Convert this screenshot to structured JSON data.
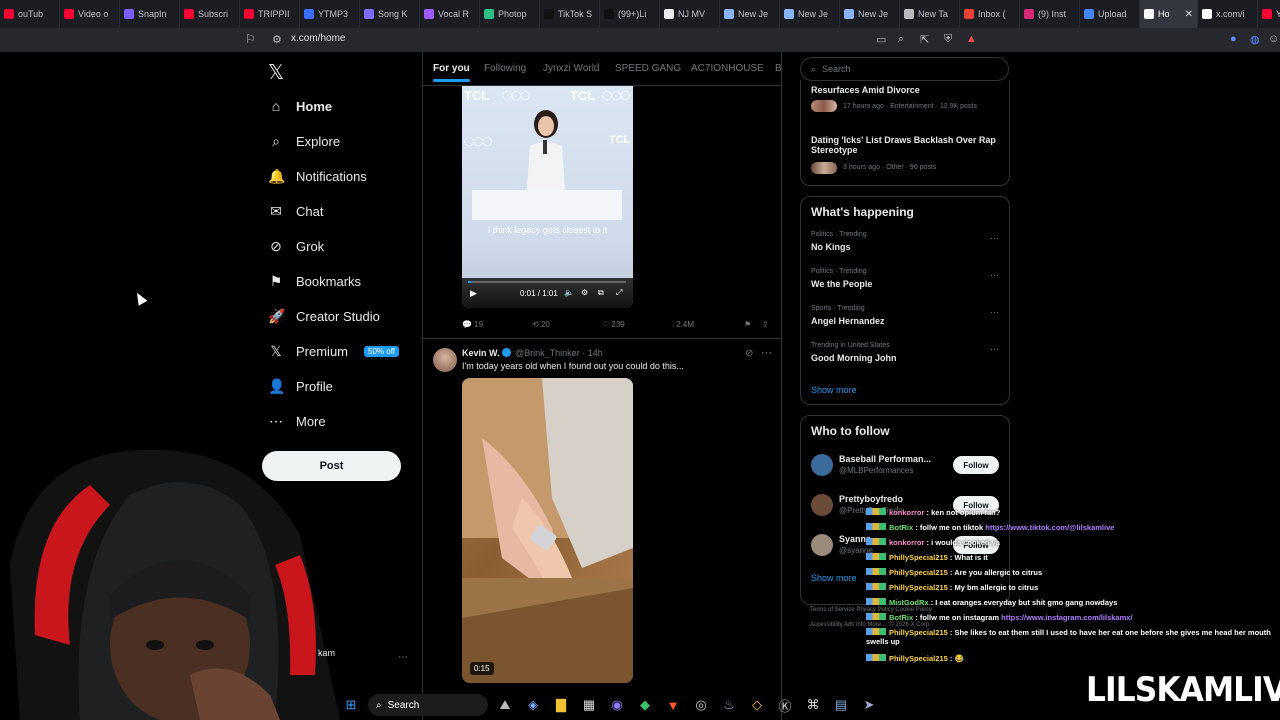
{
  "browser": {
    "tabs": [
      {
        "label": "ouTub",
        "color": "#ff0033"
      },
      {
        "label": "Video o",
        "color": "#ff0033"
      },
      {
        "label": "SnapIn",
        "color": "#7b5cff"
      },
      {
        "label": "Subscri",
        "color": "#ff0033"
      },
      {
        "label": "TRIPPII",
        "color": "#ff0033"
      },
      {
        "label": "YTMP3",
        "color": "#3b6fff"
      },
      {
        "label": "Song K",
        "color": "#7b6cff"
      },
      {
        "label": "Vocal R",
        "color": "#a05cff"
      },
      {
        "label": "Photop",
        "color": "#2bbf86"
      },
      {
        "label": "TikTok S",
        "color": "#111111"
      },
      {
        "label": "(99+)Li",
        "color": "#111111"
      },
      {
        "label": "NJ MV",
        "color": "#eeeeee"
      },
      {
        "label": "New Je",
        "color": "#8ab4f8"
      },
      {
        "label": "New Je",
        "color": "#8ab4f8"
      },
      {
        "label": "New Je",
        "color": "#8ab4f8"
      },
      {
        "label": "New Ta",
        "color": "#bbbbbb"
      },
      {
        "label": "Inbox (",
        "color": "#ea4335"
      },
      {
        "label": "(9) Inst",
        "color": "#d62976"
      },
      {
        "label": "Upload",
        "color": "#4285f4"
      },
      {
        "label": "Ho",
        "color": "#ffffff",
        "active": true,
        "close": "✕"
      },
      {
        "label": "x.com/i",
        "color": "#ffffff"
      },
      {
        "label": "YNW",
        "color": "#ff0033"
      }
    ],
    "url": "x.com/home"
  },
  "nav": {
    "items": [
      {
        "label": "Home",
        "icon": "home-icon",
        "glyph": "⌂"
      },
      {
        "label": "Explore",
        "icon": "search-icon",
        "glyph": "⌕"
      },
      {
        "label": "Notifications",
        "icon": "bell-icon",
        "glyph": "🔔"
      },
      {
        "label": "Chat",
        "icon": "mail-icon",
        "glyph": "✉"
      },
      {
        "label": "Grok",
        "icon": "grok-icon",
        "glyph": "⊘"
      },
      {
        "label": "Bookmarks",
        "icon": "bookmark-icon",
        "glyph": "⚑"
      },
      {
        "label": "Creator Studio",
        "icon": "rocket-icon",
        "glyph": "🚀"
      },
      {
        "label": "Premium",
        "icon": "x-logo-icon",
        "glyph": "𝕏",
        "badge": "50% off"
      },
      {
        "label": "Profile",
        "icon": "person-icon",
        "glyph": "👤"
      },
      {
        "label": "More",
        "icon": "more-circle-icon",
        "glyph": "⋯"
      }
    ],
    "post_label": "Post",
    "account_name": "kam"
  },
  "feed": {
    "tabs": [
      "For you",
      "Following",
      "Jynxzi World",
      "SPEED GANG",
      "AC7IONHOUSE",
      "B"
    ],
    "video1": {
      "brand": "TCL",
      "caption": "I think legacy gets closest to it",
      "time": "0:01 / 1:01",
      "progress": 0.02
    },
    "tweet1_stats": {
      "replies": "19",
      "reposts": "20",
      "likes": "239",
      "views": "2.4M"
    },
    "tweet2": {
      "name": "Kevin W.",
      "handle": "@Brink_Thinker",
      "age": "14h",
      "text": "I'm today years old when I found out you could do this...",
      "duration": "0:15"
    }
  },
  "sidebar": {
    "search_placeholder": "Search",
    "top_trends": [
      {
        "title": "Resurfaces Amid Divorce",
        "meta": "17 hours ago · Entertainment · 12.9K posts"
      },
      {
        "title": "Dating 'Icks' List Draws Backlash Over Rap Stereotype",
        "meta": "3 hours ago · Other · 96 posts"
      }
    ],
    "happening_title": "What's happening",
    "trends": [
      {
        "context": "Politics · Trending",
        "name": "No Kings"
      },
      {
        "context": "Politics · Trending",
        "name": "We the People"
      },
      {
        "context": "Sports · Trending",
        "name": "Angel Hernandez"
      },
      {
        "context": "Trending in United States",
        "name": "Good Morning John"
      }
    ],
    "show_more": "Show more",
    "who_to_follow_title": "Who to follow",
    "follow_label": "Follow",
    "suggestions": [
      {
        "name": "Baseball Performan...",
        "handle": "@MLBPerformances"
      },
      {
        "name": "Prettyboyfredo",
        "handle": "@PrettyBoyFredo"
      },
      {
        "name": "Syanne",
        "handle": "@syanne"
      }
    ],
    "follow_show_more": "Show more",
    "footer": [
      "Terms of Service  Privacy Policy  Cookie Policy",
      "Accessibility  Ads info  More ...  © 2026 X Corp."
    ]
  },
  "chat": [
    {
      "user": "konkorror",
      "text": "ken not opium fan?",
      "cls": "u"
    },
    {
      "user": "BotRix",
      "text": "follw me on tiktok ",
      "link": "https://www.tiktok.com/@lilskamlive",
      "cls": "u2"
    },
    {
      "user": "konkorror",
      "text": "i woulda cooked ya",
      "cls": "u"
    },
    {
      "user": "PhillySpecial215",
      "text": "What is it",
      "cls": "u3"
    },
    {
      "user": "PhillySpecial215",
      "text": "Are you allergic to citrus",
      "cls": "u3"
    },
    {
      "user": "PhillySpecial215",
      "text": "My bm allergic to citrus",
      "cls": "u3"
    },
    {
      "user": "MistGodRx",
      "text": "I eat oranges everyday but shit gmo gang nowdays",
      "cls": "u2"
    },
    {
      "user": "BotRix",
      "text": "follw me on instagram ",
      "link": "https://www.instagram.com/lilskamx/",
      "cls": "u2"
    },
    {
      "user": "PhillySpecial215",
      "text": "She likes to eat them still I used to have her eat one before she gives me head her mouth swells up",
      "cls": "u3"
    },
    {
      "user": "PhillySpecial215",
      "text": "😂",
      "cls": "u3"
    }
  ],
  "watermark": "LILSKAMLIVE",
  "taskbar": {
    "search_label": "Search"
  }
}
